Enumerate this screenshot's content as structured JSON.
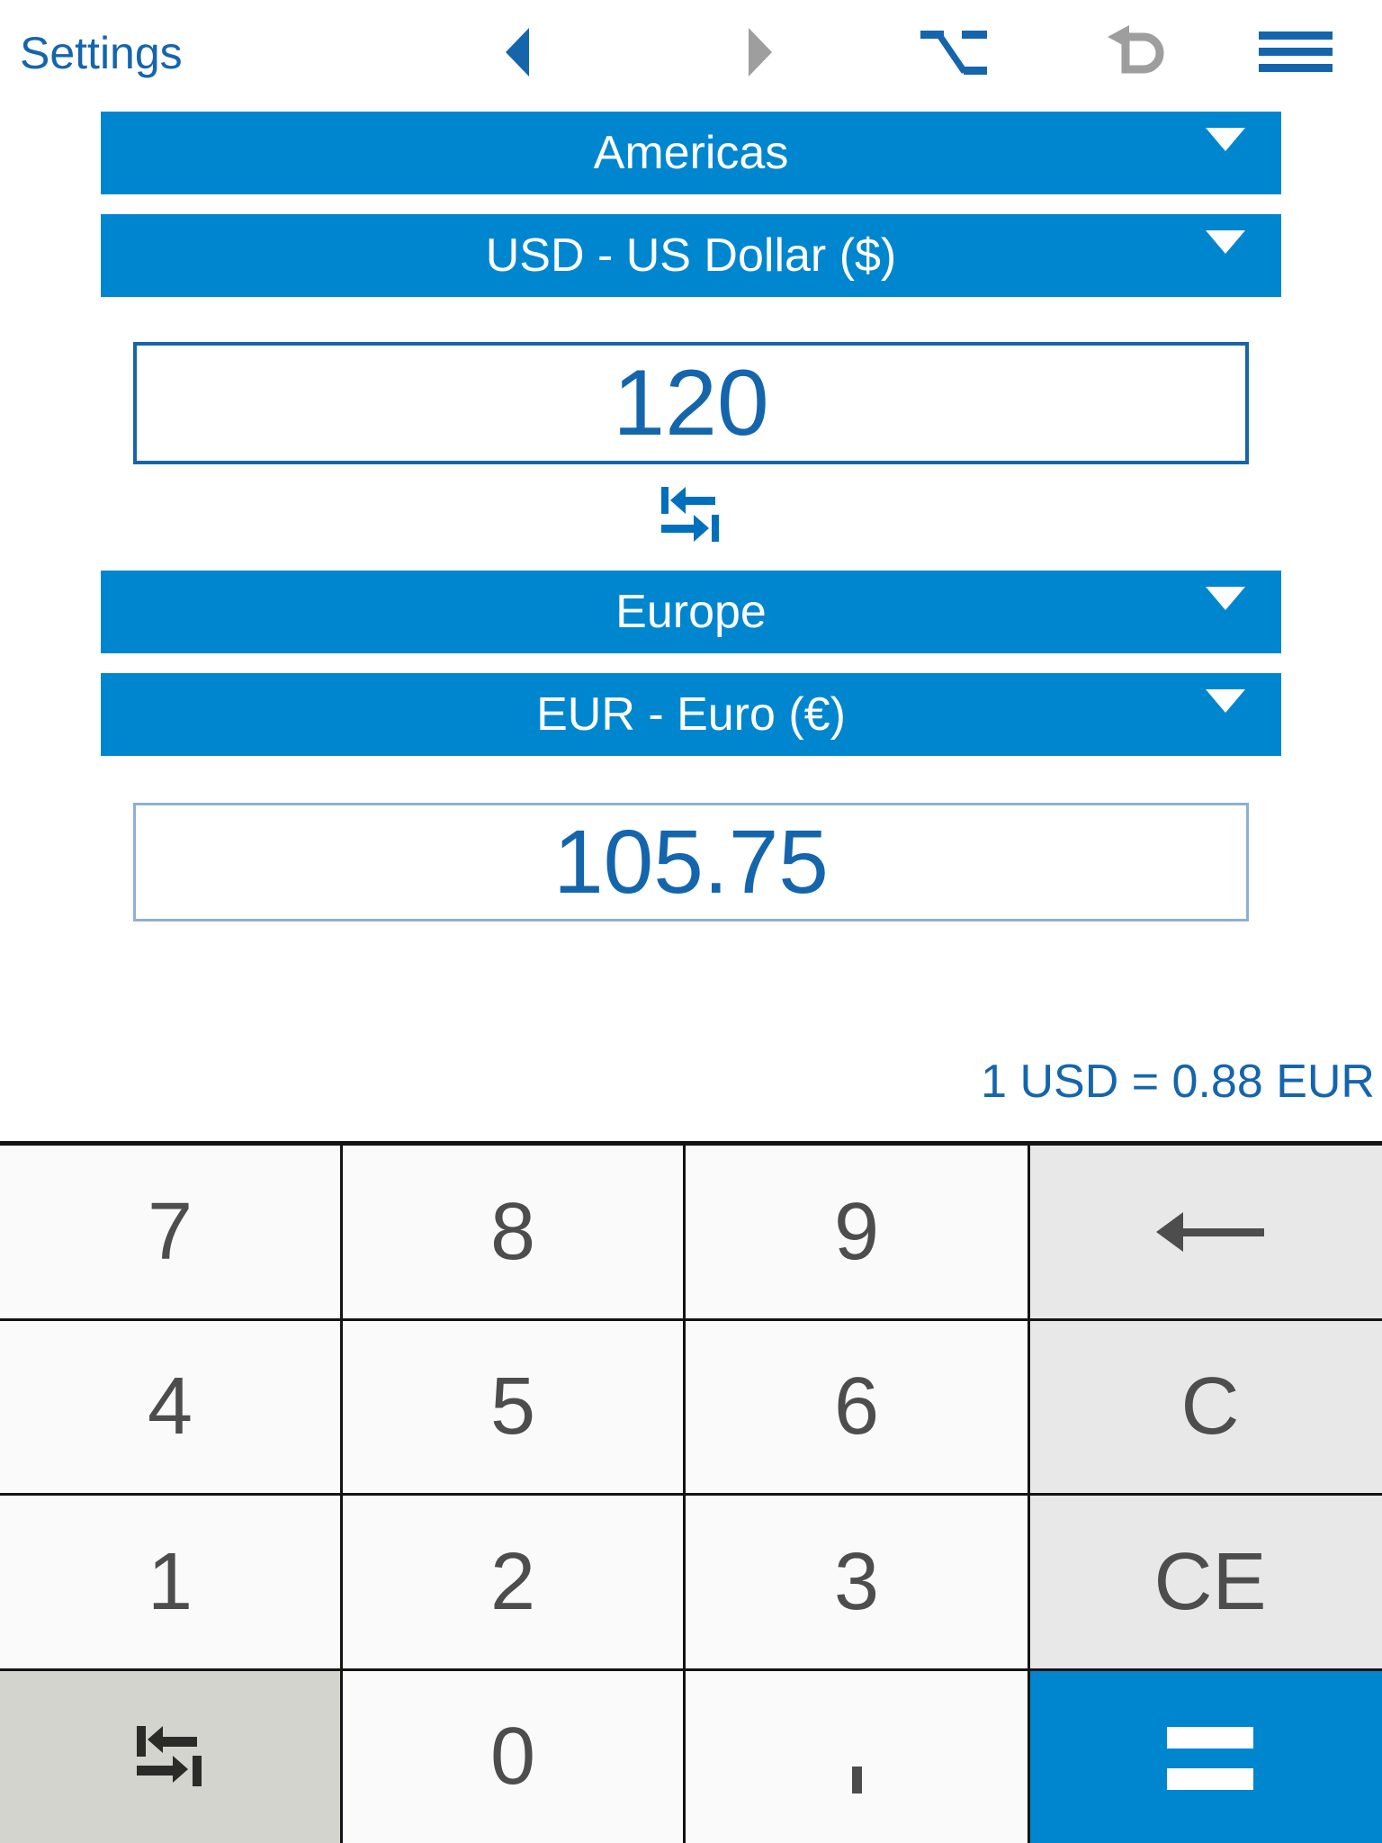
{
  "header": {
    "settings_label": "Settings",
    "icons": {
      "prev": "triangle-left-icon",
      "next": "triangle-right-icon",
      "option": "option-key-icon",
      "undo": "undo-arrow-icon",
      "menu": "hamburger-menu-icon"
    }
  },
  "converter": {
    "from": {
      "region": "Americas",
      "currency": "USD - US Dollar ($)",
      "amount": "120"
    },
    "to": {
      "region": "Europe",
      "currency": "EUR - Euro (€)",
      "amount": "105.75"
    },
    "swap_icon": "swap-arrows-icon",
    "rate_text": "1 USD = 0.88 EUR"
  },
  "keypad": {
    "rows": [
      [
        {
          "label": "7",
          "name": "key-7",
          "kind": "digit"
        },
        {
          "label": "8",
          "name": "key-8",
          "kind": "digit"
        },
        {
          "label": "9",
          "name": "key-9",
          "kind": "digit"
        },
        {
          "label": "←",
          "name": "key-backspace",
          "kind": "backspace"
        }
      ],
      [
        {
          "label": "4",
          "name": "key-4",
          "kind": "digit"
        },
        {
          "label": "5",
          "name": "key-5",
          "kind": "digit"
        },
        {
          "label": "6",
          "name": "key-6",
          "kind": "digit"
        },
        {
          "label": "C",
          "name": "key-clear",
          "kind": "fn"
        }
      ],
      [
        {
          "label": "1",
          "name": "key-1",
          "kind": "digit"
        },
        {
          "label": "2",
          "name": "key-2",
          "kind": "digit"
        },
        {
          "label": "3",
          "name": "key-3",
          "kind": "digit"
        },
        {
          "label": "CE",
          "name": "key-clear-entry",
          "kind": "fn"
        }
      ],
      [
        {
          "label": "",
          "name": "key-swap",
          "kind": "swap"
        },
        {
          "label": "0",
          "name": "key-0",
          "kind": "digit"
        },
        {
          "label": ".",
          "name": "key-decimal",
          "kind": "dot"
        },
        {
          "label": "=",
          "name": "key-equals",
          "kind": "equals"
        }
      ]
    ]
  },
  "colors": {
    "accent_blue": "#0086CE",
    "text_blue": "#1565AD",
    "key_bg": "#FAFAFA",
    "fn_key_bg": "#E8E8E8",
    "swap_key_bg": "#D3D4CD",
    "key_text": "#4D4D4D",
    "inactive_gray": "#9E9E9E"
  }
}
